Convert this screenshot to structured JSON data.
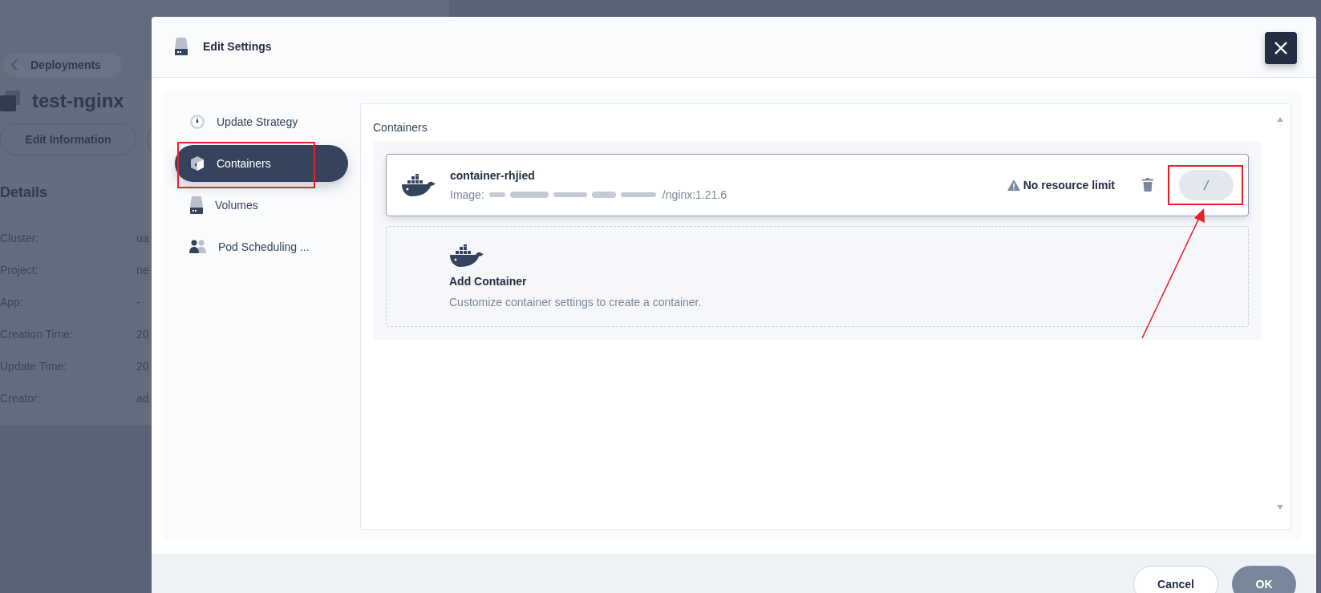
{
  "background_page": {
    "back_link": "Deployments",
    "title": "test-nginx",
    "buttons": [
      "Edit Information"
    ],
    "details_heading": "Details",
    "details": [
      {
        "label": "Cluster:",
        "value": "ua"
      },
      {
        "label": "Project:",
        "value": "ne"
      },
      {
        "label": "App:",
        "value": "-"
      },
      {
        "label": "Creation Time:",
        "value": "20"
      },
      {
        "label": "Update Time:",
        "value": "20"
      },
      {
        "label": "Creator:",
        "value": "ad"
      }
    ]
  },
  "dialog": {
    "title": "Edit Settings",
    "sidebar": {
      "items": [
        {
          "label": "Update Strategy",
          "selected": false
        },
        {
          "label": "Containers",
          "selected": true
        },
        {
          "label": "Volumes",
          "selected": false
        },
        {
          "label": "Pod Scheduling ...",
          "selected": false
        }
      ]
    },
    "section_title": "Containers",
    "containers": [
      {
        "name": "container-rhjied",
        "image_label": "Image:",
        "image": "/nginx:1.21.6",
        "resource_note": "No resource limit"
      }
    ],
    "add_card": {
      "title": "Add Container",
      "description": "Customize container settings to create a container."
    },
    "footer": {
      "cancel": "Cancel",
      "ok": "OK"
    }
  }
}
